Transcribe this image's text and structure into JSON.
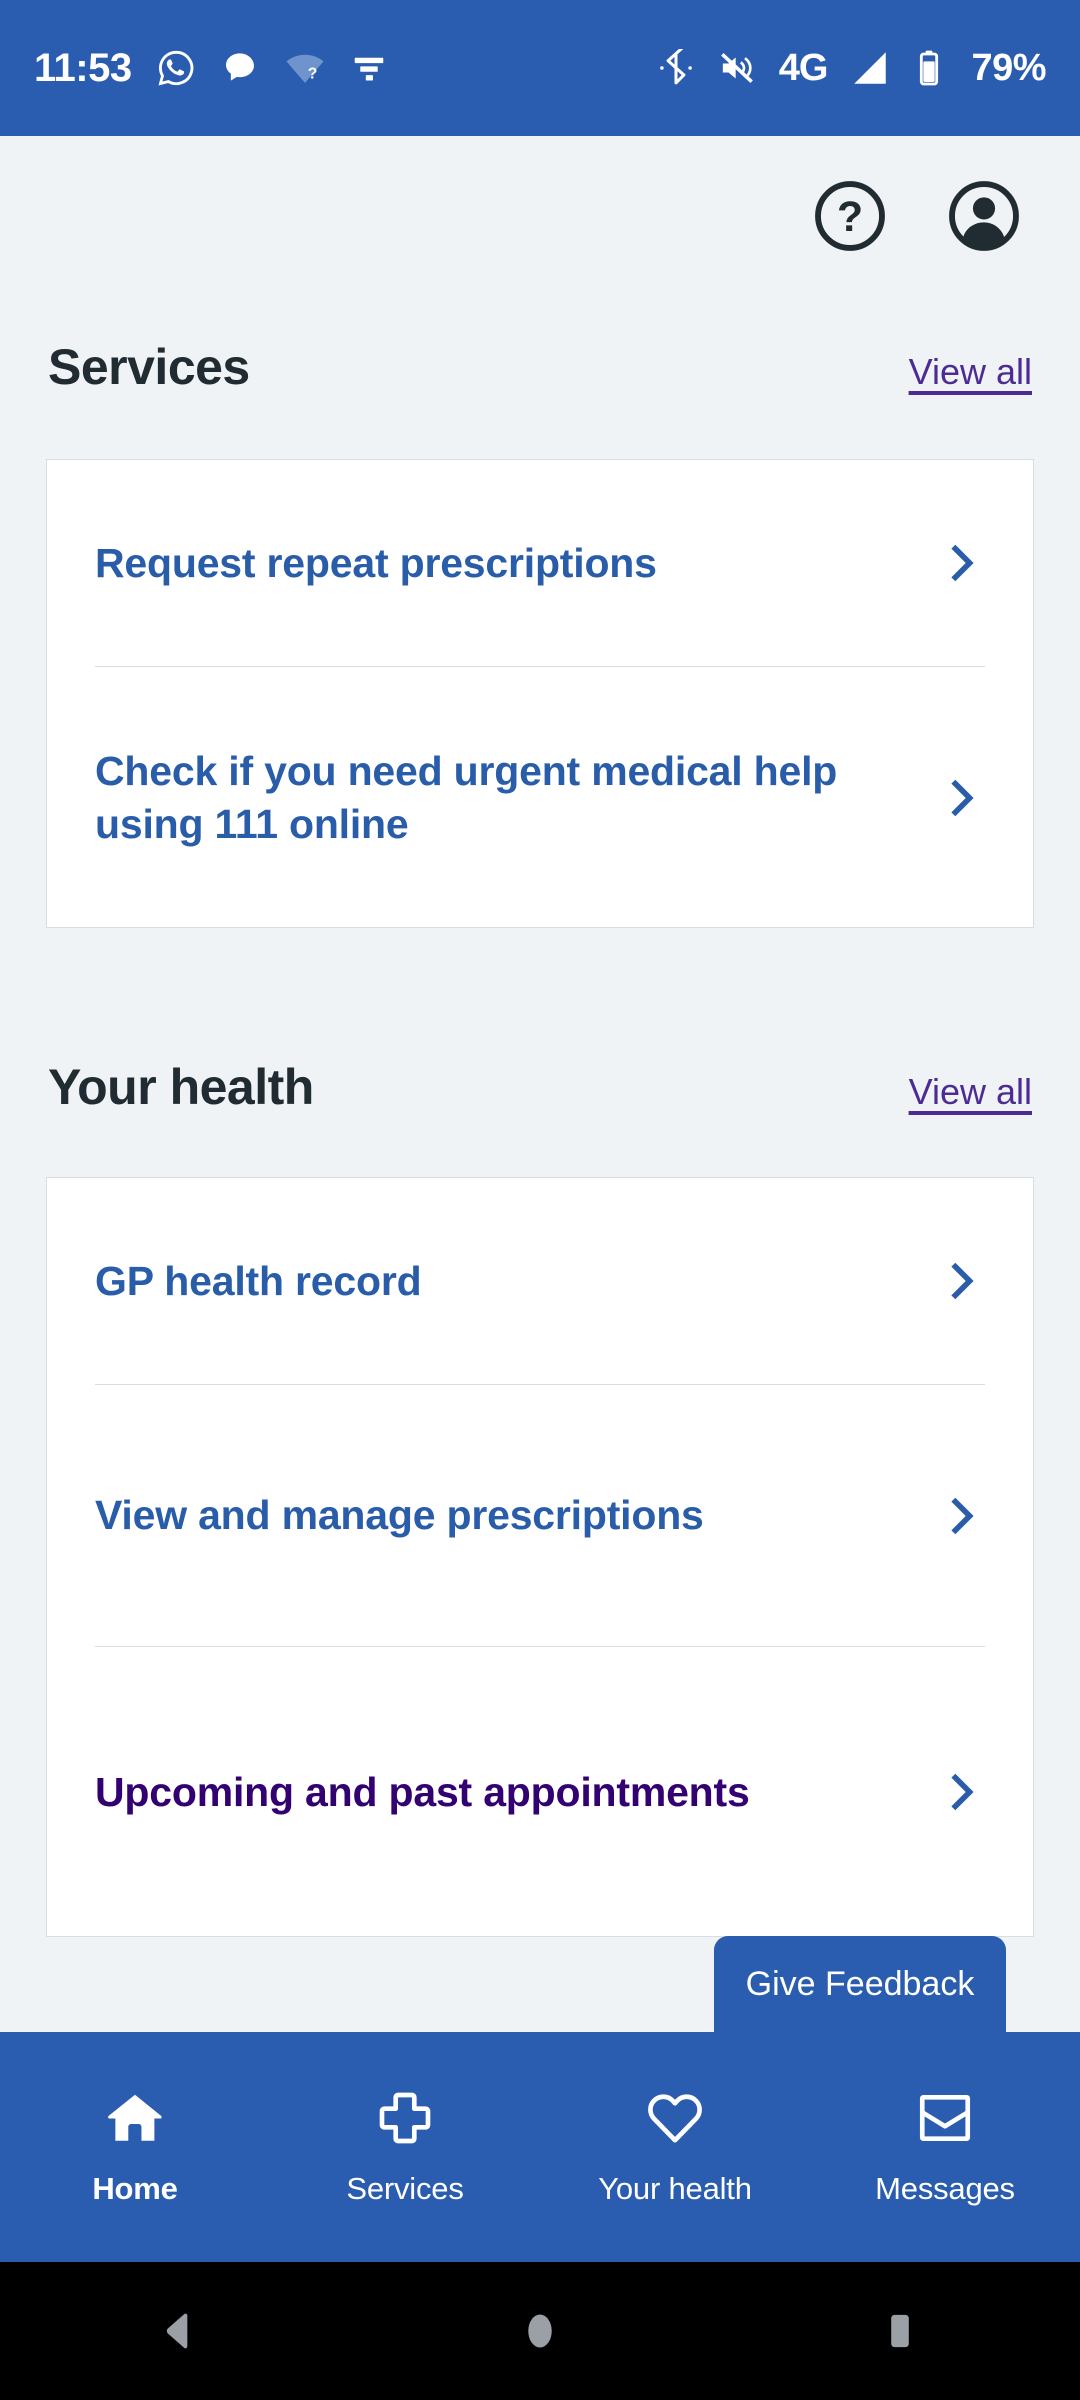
{
  "status_bar": {
    "time": "11:53",
    "network_type": "4G",
    "battery_percent": "79%",
    "left_icons": [
      "whatsapp-icon",
      "messages-icon",
      "wifi-unknown-icon",
      "data-saver-icon"
    ],
    "right_icons": [
      "bluetooth-icon",
      "ringer-muted-icon",
      "signal-icon",
      "battery-icon"
    ],
    "background_color": "#2a5db0"
  },
  "header": {
    "help_icon": "help-circle-icon",
    "account_icon": "account-circle-icon"
  },
  "sections": [
    {
      "title": "Services",
      "view_all_label": "View all",
      "items": [
        {
          "label": "Request repeat prescriptions",
          "visited": false,
          "chevron": "chevron-right-icon"
        },
        {
          "label": "Check if you need urgent medical help using 111 online",
          "visited": false,
          "chevron": "chevron-right-icon"
        }
      ]
    },
    {
      "title": "Your health",
      "view_all_label": "View all",
      "items": [
        {
          "label": "GP health record",
          "visited": false,
          "chevron": "chevron-right-icon"
        },
        {
          "label": "View and manage prescriptions",
          "visited": false,
          "chevron": "chevron-right-icon"
        },
        {
          "label": "Upcoming and past appointments",
          "visited": true,
          "chevron": "chevron-right-icon"
        }
      ]
    }
  ],
  "feedback": {
    "label": "Give Feedback"
  },
  "bottom_nav": {
    "items": [
      {
        "label": "Home",
        "icon": "home-icon",
        "active": true
      },
      {
        "label": "Services",
        "icon": "plus-cross-icon",
        "active": false
      },
      {
        "label": "Your health",
        "icon": "heart-icon",
        "active": false
      },
      {
        "label": "Messages",
        "icon": "envelope-open-icon",
        "active": false
      }
    ]
  },
  "android_nav": {
    "back": "back-triangle-icon",
    "home": "home-circle-icon",
    "recents": "recents-square-icon"
  },
  "colors": {
    "nhs_blue": "#2a5db0",
    "link_blue": "#2a5da9",
    "visited_purple": "#330072",
    "page_bg": "#eff3f5",
    "card_border": "#d8dde0",
    "text_dark": "#212b32"
  }
}
